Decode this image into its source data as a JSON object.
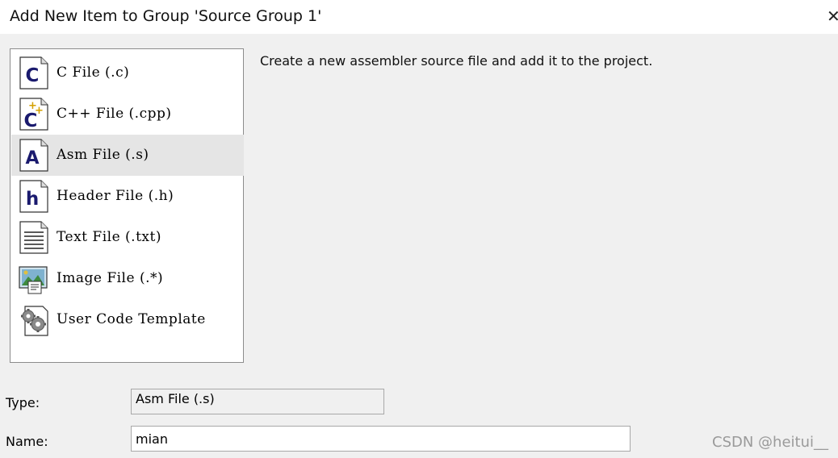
{
  "dialog": {
    "title": "Add New Item to Group 'Source Group 1'",
    "close_glyph": "×"
  },
  "file_types": [
    {
      "label": "C File (.c)",
      "icon": "c-file-icon",
      "selected": false
    },
    {
      "label": "C++ File (.cpp)",
      "icon": "cpp-file-icon",
      "selected": false
    },
    {
      "label": "Asm File (.s)",
      "icon": "asm-file-icon",
      "selected": true
    },
    {
      "label": "Header File (.h)",
      "icon": "header-file-icon",
      "selected": false
    },
    {
      "label": "Text File (.txt)",
      "icon": "text-file-icon",
      "selected": false
    },
    {
      "label": "Image File (.*)",
      "icon": "image-file-icon",
      "selected": false
    },
    {
      "label": "User Code Template",
      "icon": "template-gears-icon",
      "selected": false
    }
  ],
  "description": "Create a new assembler source file and add it to the project.",
  "form": {
    "type_label": "Type:",
    "type_value": "Asm File (.s)",
    "name_label": "Name:",
    "name_value": "mian"
  },
  "watermark": "CSDN @heitui__",
  "colors": {
    "selection": "#e5e5e5",
    "icon_letter": "#1a1a6e"
  }
}
